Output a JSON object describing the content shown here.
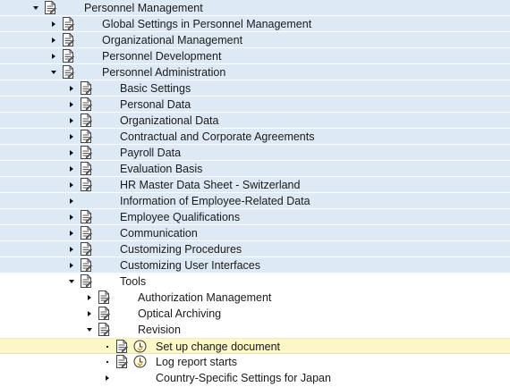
{
  "tree": {
    "items": [
      {
        "label": "Personnel Management",
        "state": "expanded",
        "icon": "document-icon",
        "level": 0
      },
      {
        "label": "Global Settings in Personnel Management",
        "state": "collapsed",
        "icon": "document-icon",
        "level": 1
      },
      {
        "label": "Organizational Management",
        "state": "collapsed",
        "icon": "document-icon",
        "level": 1
      },
      {
        "label": "Personnel Development",
        "state": "collapsed",
        "icon": "document-icon",
        "level": 1
      },
      {
        "label": "Personnel Administration",
        "state": "expanded",
        "icon": "document-icon",
        "level": 1
      },
      {
        "label": "Basic Settings",
        "state": "collapsed",
        "icon": "document-icon",
        "level": 2
      },
      {
        "label": "Personal Data",
        "state": "collapsed",
        "icon": "document-icon",
        "level": 2
      },
      {
        "label": "Organizational Data",
        "state": "collapsed",
        "icon": "document-icon",
        "level": 2
      },
      {
        "label": "Contractual and Corporate Agreements",
        "state": "collapsed",
        "icon": "document-icon",
        "level": 2
      },
      {
        "label": "Payroll Data",
        "state": "collapsed",
        "icon": "document-icon",
        "level": 2
      },
      {
        "label": "Evaluation Basis",
        "state": "collapsed",
        "icon": "document-icon",
        "level": 2
      },
      {
        "label": "HR Master Data Sheet - Switzerland",
        "state": "collapsed",
        "icon": "document-icon",
        "level": 2
      },
      {
        "label": "Information of Employee-Related Data",
        "state": "collapsed",
        "icon": "",
        "level": 2
      },
      {
        "label": "Employee Qualifications",
        "state": "collapsed",
        "icon": "document-icon",
        "level": 2
      },
      {
        "label": "Communication",
        "state": "collapsed",
        "icon": "document-icon",
        "level": 2
      },
      {
        "label": "Customizing Procedures",
        "state": "collapsed",
        "icon": "document-icon",
        "level": 2
      },
      {
        "label": "Customizing User Interfaces",
        "state": "collapsed",
        "icon": "document-icon",
        "level": 2
      },
      {
        "label": "Tools",
        "state": "expanded",
        "icon": "document-icon",
        "level": 2
      },
      {
        "label": "Authorization Management",
        "state": "collapsed",
        "icon": "document-icon",
        "level": 3
      },
      {
        "label": "Optical Archiving",
        "state": "collapsed",
        "icon": "document-icon",
        "level": 3
      },
      {
        "label": "Revision",
        "state": "expanded",
        "icon": "document-icon",
        "level": 3
      },
      {
        "label": "Set up change document",
        "state": "leaf",
        "icon": "document-icon",
        "icon2": "execute-clock-icon",
        "level": 4,
        "selected": true
      },
      {
        "label": "Log report starts",
        "state": "leaf",
        "icon": "document-icon",
        "icon2": "execute-clock-icon",
        "level": 4
      },
      {
        "label": "Country-Specific Settings for Japan",
        "state": "collapsed",
        "icon": "",
        "level": 4
      }
    ]
  },
  "colors": {
    "shaded_row": "#dde9f5",
    "selected_row": "#fbf8c7"
  }
}
